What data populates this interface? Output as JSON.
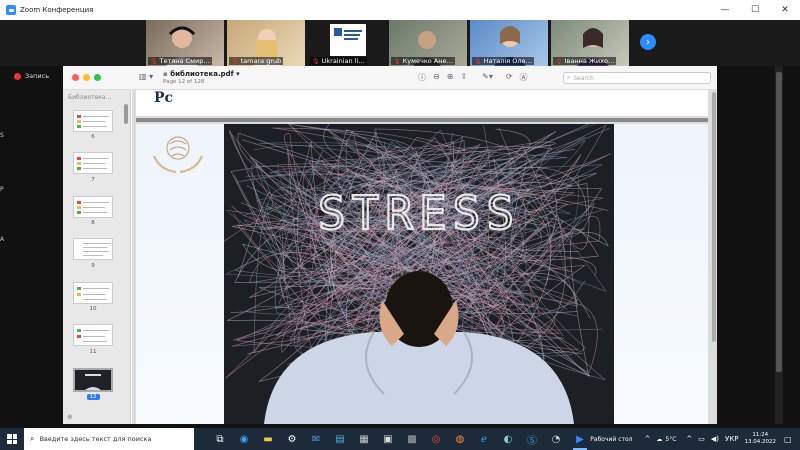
{
  "zoom": {
    "title": "Zoom Конференция",
    "recording_label": "Запись",
    "participants": [
      {
        "name": "Тетяна Смир…"
      },
      {
        "name": "tamara grub"
      },
      {
        "name": "Ukrainian li…"
      },
      {
        "name": "Кумечко Ане…"
      },
      {
        "name": "Наталія Оле…"
      },
      {
        "name": "Іванна Жихо…"
      }
    ],
    "colors": {
      "accent": "#2d8cff",
      "record": "#e33333"
    }
  },
  "preview": {
    "doc_title": "библиотека.pdf",
    "page_info": "Page 12 of 128",
    "search_placeholder": "Search",
    "sidebar_title": "Библиотека…",
    "thumbnails": [
      {
        "num": "6"
      },
      {
        "num": "7"
      },
      {
        "num": "8"
      },
      {
        "num": "9"
      },
      {
        "num": "10"
      },
      {
        "num": "11"
      },
      {
        "num": "12",
        "selected": true
      }
    ],
    "prev_page_letters": "Pc",
    "image_text": "STRESS"
  },
  "taskbar": {
    "search_placeholder": "Введите здесь текст для поиска",
    "desktop_label": "Рабочий стол",
    "weather": "5°C",
    "lang": "УКР",
    "time": "11:24",
    "date": "13.04.2022"
  }
}
